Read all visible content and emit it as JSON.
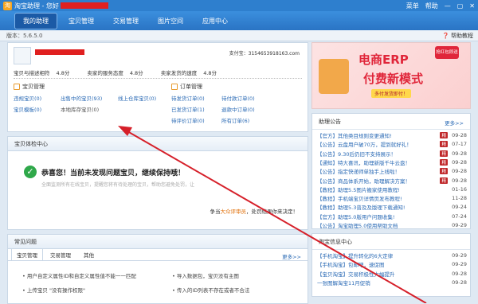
{
  "window": {
    "logo_icon": "taobao-logo-icon",
    "title": "淘宝助理 - 您好",
    "controls": [
      "菜单",
      "帮助"
    ]
  },
  "nav": {
    "tabs": [
      "我的助理",
      "宝贝管理",
      "交易管理",
      "图片空间",
      "应用中心"
    ]
  },
  "version": {
    "label": "版本：5.6.5.0",
    "help": "帮助教程"
  },
  "profile": {
    "alipay_label": "支付宝：3154653918163.com",
    "ratings": [
      {
        "label": "宝贝与描述相符",
        "value": "4.8分"
      },
      {
        "label": "卖家的服务态度",
        "value": "4.8分"
      },
      {
        "label": "卖家发货的速度",
        "value": "4.8分"
      }
    ]
  },
  "goods": {
    "title": "宝贝管理",
    "links": [
      "违规宝贝(0)",
      "出售中的宝贝(93)",
      "线上仓库宝贝(0)",
      "宝贝模板(0)",
      "本地库存宝贝(0)"
    ]
  },
  "orders": {
    "title": "订单管理",
    "links": [
      "待发货订单(0)",
      "待付款订单(0)",
      "已发货订单(1)",
      "退款中订单(0)",
      "待评价订单(0)",
      "所有订单(6)"
    ]
  },
  "check": {
    "header": "宝贝体检中心",
    "message": "恭喜您！当前未发现问题宝贝，继续保持哦！",
    "sub": "全面监测所有在线宝贝，提醒您将有待处理的宝贝，帮助您避免处罚，让",
    "footer_prefix": "争当",
    "footer_highlight": "大众评审员",
    "footer_suffix": "，处罚结果你来决定！"
  },
  "faq": {
    "header": "常见问题",
    "tabs": [
      "宝贝管理",
      "交易管理",
      "其他"
    ],
    "more": "更多>>",
    "items": [
      "用户自定义属性ID和自定义属性值不能一一匹配",
      "导入数据包，宝贝没有主图",
      "上传宝贝 \"没有操作权限\"",
      "传入的ID列表不存在或者不合法"
    ]
  },
  "banner": {
    "line1": "电商ERP",
    "line2": "付费新模式",
    "tagline": "多付发货即付！",
    "badge": "抢红包即送"
  },
  "announcements": {
    "header": "助理公告",
    "more": "更多>>",
    "hot": "精",
    "items": [
      {
        "text": "【官方】其他类目规则变更通知!",
        "date": "09-28",
        "hot": true
      },
      {
        "text": "【公告】云盘用户破70万，提到就好礼！",
        "date": "07-17",
        "hot": true
      },
      {
        "text": "【公告】9.30后仍旧不支持展示！",
        "date": "09-28",
        "hot": true
      },
      {
        "text": "【通知】特大喜讯，助理新版千牛云盘！",
        "date": "09-28",
        "hot": true
      },
      {
        "text": "【公告】指定快递师单独手上线啦！",
        "date": "09-28",
        "hot": true
      },
      {
        "text": "【公告】商品体系开始，助理解决方案！",
        "date": "09-28",
        "hot": true
      },
      {
        "text": "【教程】助理5.5图片搬家使用教程!",
        "date": "01-16",
        "hot": false
      },
      {
        "text": "【教程】手机端宝贝详情页发布教程!",
        "date": "11-28",
        "hot": false
      },
      {
        "text": "【教程】助理5.3普及及版理下载通知!",
        "date": "09-24",
        "hot": false
      },
      {
        "text": "【官方】助理5.0版用户问题收集!",
        "date": "07-24",
        "hot": false
      },
      {
        "text": "【公告】淘宝助理5.0使用帮助文档",
        "date": "09-29",
        "hot": false
      }
    ]
  },
  "news": {
    "header": "淘宝信息中心",
    "items": [
      {
        "text": "【手机淘宝】提升转化的6大定律",
        "date": "09-29"
      },
      {
        "text": "【手机淘宝】包邮吧，速促图",
        "date": "09-29"
      },
      {
        "text": "【宝贝淘宝】交易积极性大幅提升",
        "date": "09-28"
      },
      {
        "text": "一张图解淘宝11月促销",
        "date": "09-28"
      }
    ]
  }
}
